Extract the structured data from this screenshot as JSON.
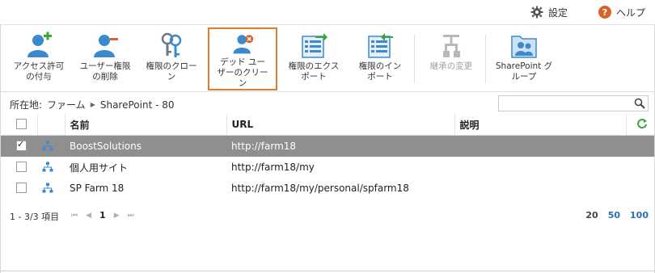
{
  "topbar": {
    "settings_label": "設定",
    "help_label": "ヘルプ"
  },
  "ribbon": {
    "buttons": [
      {
        "label": "アクセス許可\nの付与",
        "icon": "user-add-icon"
      },
      {
        "label": "ユーザー権限\nの削除",
        "icon": "user-remove-icon"
      },
      {
        "label": "権限のクロー\nン",
        "icon": "keys-icon"
      },
      {
        "label": "デッド ユー\nザーのクリー\nン",
        "icon": "user-delete-icon"
      },
      {
        "label": "権限のエクス\nポート",
        "icon": "export-icon"
      },
      {
        "label": "権限のイン\nポート",
        "icon": "import-icon"
      },
      {
        "label": "継承の変更",
        "icon": "inheritance-icon"
      },
      {
        "label": "SharePoint グ\nループ",
        "icon": "group-icon"
      }
    ],
    "selected_index": 3
  },
  "location": {
    "prefix": "所在地:",
    "crumbs": [
      "ファーム",
      "SharePoint - 80"
    ]
  },
  "search": {
    "placeholder": ""
  },
  "table": {
    "headers": {
      "name": "名前",
      "url": "URL",
      "description": "説明"
    },
    "rows": [
      {
        "checked": true,
        "selected": true,
        "name": "BoostSolutions",
        "url": "http://farm18",
        "description": ""
      },
      {
        "checked": false,
        "selected": false,
        "name": "個人用サイト",
        "url": "http://farm18/my",
        "description": ""
      },
      {
        "checked": false,
        "selected": false,
        "name": "SP Farm 18",
        "url": "http://farm18/my/personal/spfarm18",
        "description": ""
      }
    ]
  },
  "pager": {
    "info": "1 - 3/3 項目",
    "current_page": "1",
    "page_sizes": [
      "20",
      "50",
      "100"
    ]
  },
  "colors": {
    "selected_row": "#8f8f8f",
    "highlight_border": "#e07c2b",
    "icon_blue": "#3b8ad0",
    "link": "#2a6fb8"
  }
}
